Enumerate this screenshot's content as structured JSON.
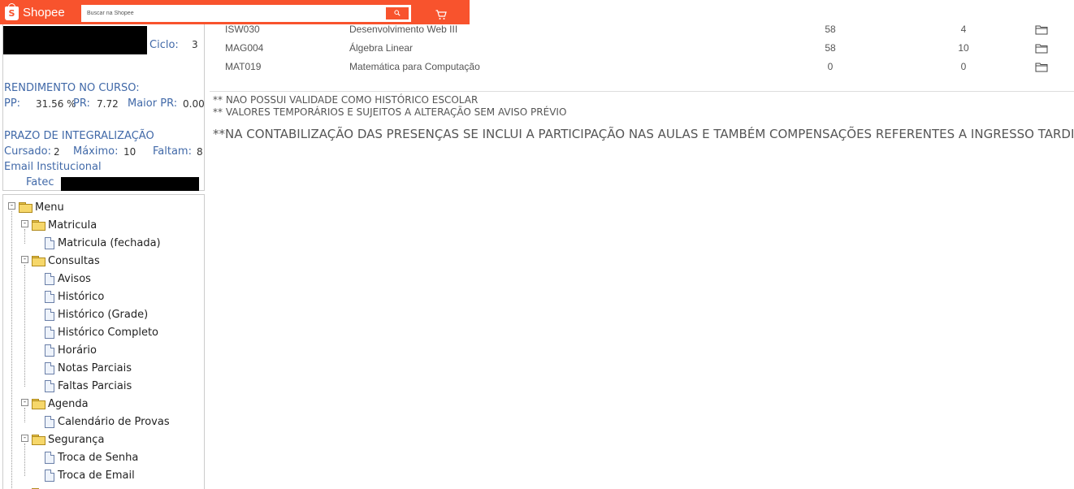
{
  "shopee": {
    "brand": "Shopee",
    "logo_letter": "S",
    "search_placeholder": "Buscar na Shopee",
    "search_icon": "search-icon",
    "cart_icon": "cart-icon",
    "brand_color": "#f8532d"
  },
  "student": {
    "ciclo_label": "Ciclo:",
    "ciclo_value": "3",
    "rendimento_label": "RENDIMENTO NO CURSO:",
    "pp_label": "PP:",
    "pp_value": "31.56 %",
    "pr_label": "PR:",
    "pr_value": "7.72",
    "maior_pr_label": "Maior PR:",
    "maior_pr_value": "0.00",
    "prazo_label": "PRAZO DE INTEGRALIZAÇÃO",
    "cursado_label": "Cursado:",
    "cursado_value": "2",
    "maximo_label": "Máximo:",
    "maximo_value": "10",
    "faltam_label": "Faltam:",
    "faltam_value": "8",
    "email_label": "Email Institucional",
    "fatec_label": "Fatec"
  },
  "menu": {
    "root": "Menu",
    "groups": [
      {
        "label": "Matricula",
        "items": [
          "Matricula (fechada)"
        ]
      },
      {
        "label": "Consultas",
        "items": [
          "Avisos",
          "Histórico",
          "Histórico (Grade)",
          "Histórico Completo",
          "Horário",
          "Notas Parciais",
          "Faltas Parciais"
        ]
      },
      {
        "label": "Agenda",
        "items": [
          "Calendário de Provas"
        ]
      },
      {
        "label": "Segurança",
        "items": [
          "Troca de Senha",
          "Troca de Email"
        ]
      }
    ]
  },
  "courses": [
    {
      "code": "ISW030",
      "name": "Desenvolvimento Web III",
      "n1": "58",
      "n2": "4"
    },
    {
      "code": "MAG004",
      "name": "Álgebra Linear",
      "n1": "58",
      "n2": "10"
    },
    {
      "code": "MAT019",
      "name": "Matemática para Computação",
      "n1": "0",
      "n2": "0"
    }
  ],
  "notes": {
    "note1": "** NAO POSSUI VALIDADE COMO HISTÓRICO ESCOLAR",
    "note2": "** VALORES TEMPORÁRIOS E SUJEITOS A ALTERAÇÃO SEM AVISO PRÉVIO",
    "note3": "**NA CONTABILIZAÇÃO DAS PRESENÇAS SE INCLUI A PARTICIPAÇÃO NAS AULAS E TAMBÉM COMPENSAÇÕES REFERENTES A INGRESSO TARDIO"
  }
}
